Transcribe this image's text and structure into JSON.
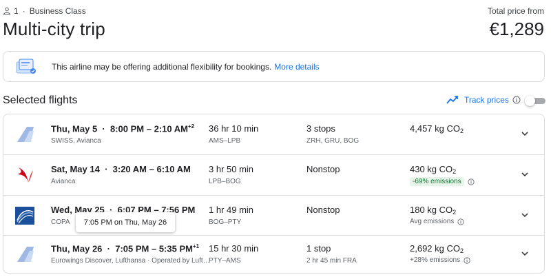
{
  "header": {
    "passengers": "1",
    "cabin": "Business Class",
    "trip_title": "Multi-city trip",
    "price_label": "Total price from",
    "price": "€1,289"
  },
  "banner": {
    "text": "This airline may be offering additional flexibility for bookings.",
    "link": "More details"
  },
  "selected": {
    "title": "Selected flights",
    "track_label": "Track prices",
    "track_enabled": false
  },
  "tooltip": "7:05 PM on Thu, May 26",
  "flights": [
    {
      "logo": "swiss-tail-icon",
      "date": "Thu, May 5",
      "times": "8:00 PM – 2:10 AM",
      "day_offset": "+2",
      "airline": "SWISS, Avianca",
      "duration": "36 hr 10 min",
      "route": "AMS–LPB",
      "stops": "3 stops",
      "stop_info": "ZRH, GRU, BOG",
      "co2": "4,457 kg CO",
      "co2_sub": "2",
      "emissions": "",
      "emissions_badge": ""
    },
    {
      "logo": "avianca-bird-icon",
      "date": "Sat, May 14",
      "times": "3:20 AM – 6:10 AM",
      "day_offset": "",
      "airline": "Avianca",
      "duration": "3 hr 50 min",
      "route": "LPB–BOG",
      "stops": "Nonstop",
      "stop_info": "",
      "co2": "430 kg CO",
      "co2_sub": "2",
      "emissions": "",
      "emissions_badge": "-69% emissions"
    },
    {
      "logo": "copa-globe-icon",
      "date": "Wed, May 25",
      "times": "6:07 PM – 7:56 PM",
      "day_offset": "",
      "airline": "COPA",
      "duration": "1 hr 49 min",
      "route": "BOG–PTY",
      "stops": "Nonstop",
      "stop_info": "",
      "co2": "180 kg CO",
      "co2_sub": "2",
      "emissions": "Avg emissions",
      "emissions_badge": ""
    },
    {
      "logo": "eurowings-tail-icon",
      "date": "Thu, May 26",
      "times": "7:05 PM – 5:35 PM",
      "day_offset": "+1",
      "airline": "Eurowings Discover, Lufthansa · Operated by Luft…",
      "duration": "15 hr 30 min",
      "route": "PTY–AMS",
      "stops": "1 stop",
      "stop_info": "2 hr 45 min FRA",
      "co2": "2,692 kg CO",
      "co2_sub": "2",
      "emissions": "+28% emissions",
      "emissions_badge": ""
    }
  ],
  "colors": {
    "accent": "#1a73e8",
    "border": "#dadce0",
    "badge_bg": "#e6f4ea",
    "badge_text": "#137333"
  }
}
